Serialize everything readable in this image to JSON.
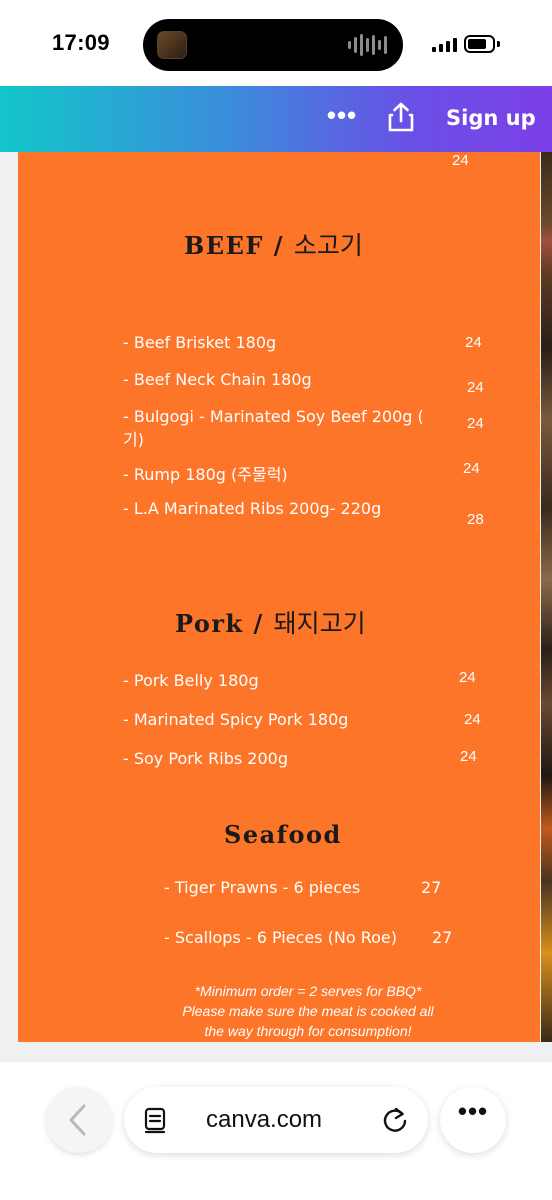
{
  "status_bar": {
    "time": "17:09"
  },
  "header": {
    "more_label": "•••",
    "signup_label": "Sign up"
  },
  "menu": {
    "top_price": "24",
    "beef": {
      "heading": "BEEF /",
      "heading_kr": "소고기",
      "items": [
        {
          "name": "- Beef Brisket 180g",
          "price": "24"
        },
        {
          "name": "- Beef Neck Chain 180g",
          "price": "24"
        },
        {
          "name": "- Bulgogi - Marinated Soy Beef 200g (",
          "name_cont": "기)",
          "price": "24"
        },
        {
          "name": "- Rump 180g (주물럭)",
          "price": "24"
        },
        {
          "name": "- L.A Marinated Ribs 200g- 220g",
          "price": "28"
        }
      ]
    },
    "pork": {
      "heading": "Pork /",
      "heading_kr": "돼지고기",
      "items": [
        {
          "name": "- Pork Belly 180g",
          "price": "24"
        },
        {
          "name": "- Marinated Spicy Pork 180g",
          "price": "24"
        },
        {
          "name": "- Soy Pork Ribs 200g",
          "price": "24"
        }
      ]
    },
    "seafood": {
      "heading": "Seafood",
      "items": [
        {
          "name": "- Tiger Prawns - 6 pieces",
          "price": "27"
        },
        {
          "name": "- Scallops - 6 Pieces (No Roe)",
          "price": "27"
        }
      ]
    },
    "note_lines": [
      "*Minimum order = 2 serves for BBQ*",
      "Please make sure the meat is cooked all",
      "the way through for consumption!"
    ]
  },
  "browser": {
    "url": "canva.com",
    "more_label": "•••"
  },
  "colors": {
    "menu_bg": "#fd7528",
    "header_start": "#12c6c9",
    "header_end": "#7c3fe7"
  }
}
